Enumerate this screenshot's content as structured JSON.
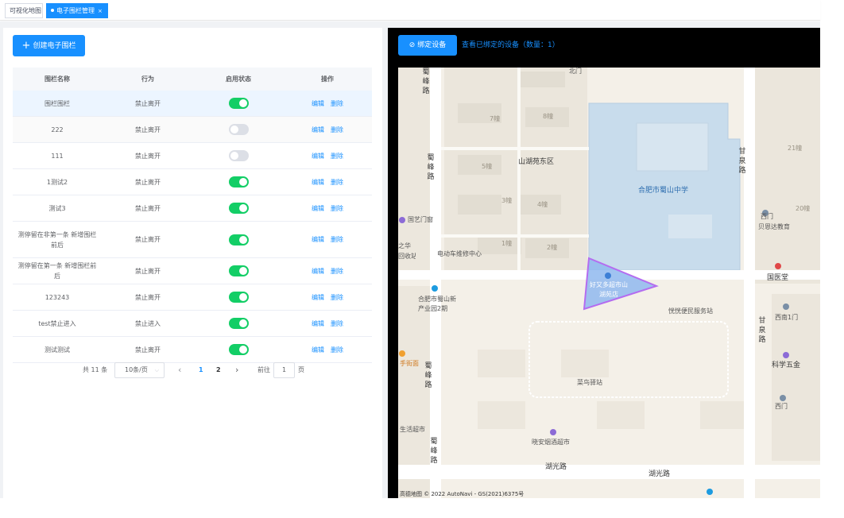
{
  "tabs": [
    {
      "label": "可视化地图",
      "active": false
    },
    {
      "label": "电子围栏管理",
      "active": true,
      "close": "×"
    }
  ],
  "left": {
    "create_button": "创建电子围栏",
    "columns": [
      "围栏名称",
      "行为",
      "启用状态",
      "操作"
    ],
    "rows": [
      {
        "name": "围栏围栏",
        "action": "禁止离开",
        "enabled": true
      },
      {
        "name": "222",
        "action": "禁止离开",
        "enabled": false
      },
      {
        "name": "111",
        "action": "禁止离开",
        "enabled": false
      },
      {
        "name": "1测试2",
        "action": "禁止离开",
        "enabled": true
      },
      {
        "name": "测试3",
        "action": "禁止离开",
        "enabled": true
      },
      {
        "name": "测停留在非第一条 新增围栏前后",
        "action": "禁止离开",
        "enabled": true
      },
      {
        "name": "测停留在第一条 新增围栏前后",
        "action": "禁止离开",
        "enabled": true
      },
      {
        "name": "123243",
        "action": "禁止离开",
        "enabled": true
      },
      {
        "name": "test禁止进入",
        "action": "禁止进入",
        "enabled": true
      },
      {
        "name": "测试测试",
        "action": "禁止离开",
        "enabled": true
      }
    ],
    "edit_label": "编辑",
    "delete_label": "删除",
    "pagination": {
      "total": "共 11 条",
      "page_size": "10条/页",
      "prev": "‹",
      "pages": [
        "1",
        "2"
      ],
      "current_page": "1",
      "next": "›",
      "goto_label": "前往",
      "goto_value": "1",
      "page_unit": "页"
    }
  },
  "right": {
    "bind_button": "绑定设备",
    "view_link": "查看已绑定的设备（数量：1）",
    "map": {
      "labels": {
        "north_gate": "北门",
        "community": "山湖苑东区",
        "school": "合肥市蜀山中学",
        "b7": "7幢",
        "b8": "8幢",
        "b5": "5幢",
        "b3": "3幢",
        "b4": "4幢",
        "b1": "1幢",
        "b2": "2幢",
        "road_shufeng": "蜀峰路",
        "road_ganquan": "甘泉路",
        "road_huguang": "湖光路",
        "guoyi": "国艺门窗",
        "ebike": "电动车维修中心",
        "zhihua": "之华",
        "shoubu": "回收站",
        "park": "合肥市蜀山新产业园2期",
        "fence_store": "好又多超市山湖苑店",
        "service": "恍恍便民服务站",
        "cainiao": "菜鸟驿站",
        "bookstore": "贝恩达教育",
        "west_gate": "西门",
        "guojitang": "国医堂",
        "south_gate1": "西南1门",
        "science": "科学五金",
        "south_gate2": "西门",
        "xiaoan": "晓安烟酒超市",
        "shouhu": "手街面",
        "life": "生活超市",
        "b21": "21幢",
        "b20": "20幢",
        "copyright": "高德地图 © 2022 AutoNavi - GS(2021)6375号"
      }
    }
  },
  "colors": {
    "primary": "#1890ff",
    "switch_on": "#13ce66",
    "switch_off": "#dcdfe6",
    "fence_fill": "#8fb8ef",
    "fence_stroke": "#b46cf0"
  }
}
